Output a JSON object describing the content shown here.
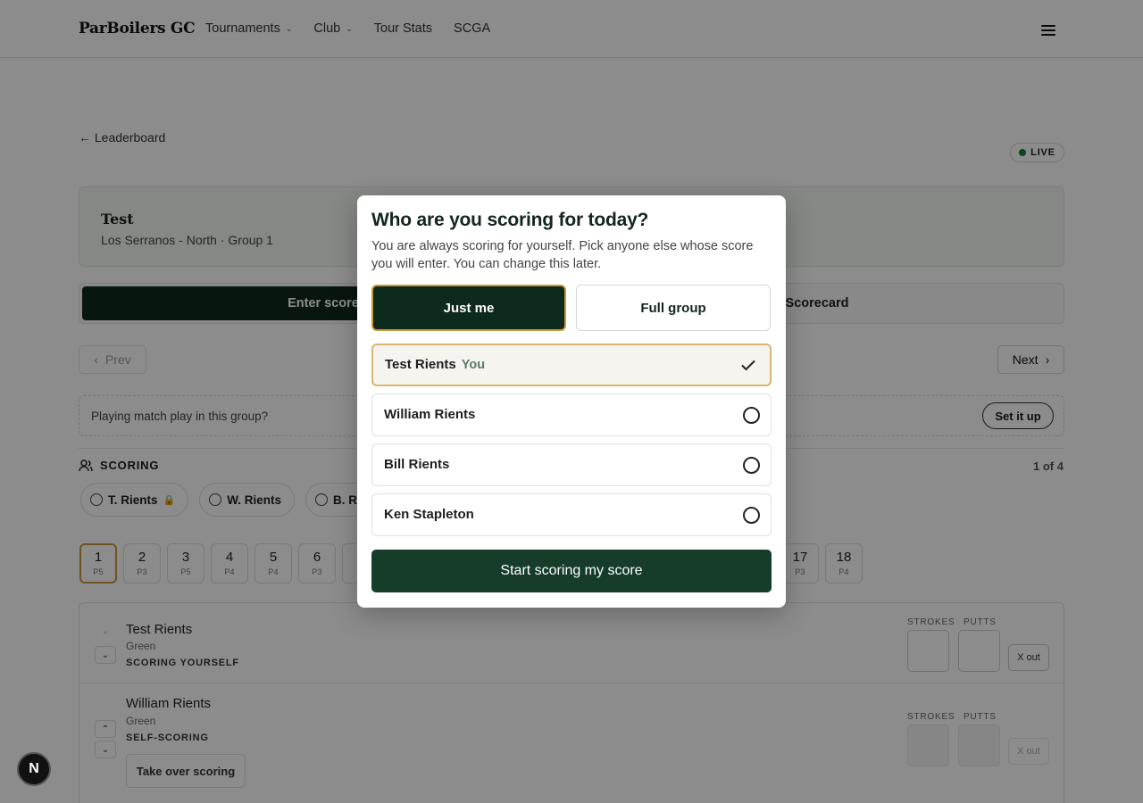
{
  "header": {
    "brand": "ParBoilers GC",
    "nav": [
      {
        "label": "Tournaments",
        "dropdown": true
      },
      {
        "label": "Club",
        "dropdown": true
      },
      {
        "label": "Tour Stats",
        "dropdown": false
      },
      {
        "label": "SCGA",
        "dropdown": false
      }
    ]
  },
  "page": {
    "back_label": "← Leaderboard",
    "live_label": "LIVE",
    "event_title": "Test",
    "event_sub": "Los Serranos - North · Group 1",
    "tabs": {
      "enter": "Enter scores",
      "scorecard": "Scorecard"
    },
    "prev_label": "Prev",
    "next_label": "Next",
    "match_text": "Playing match play in this group?",
    "setup_label": "Set it up",
    "scoring_label": "SCORING",
    "count_label": "1 of 4",
    "chips": [
      "T. Rients",
      "W. Rients",
      "B. Rients"
    ],
    "holes": [
      {
        "num": "1",
        "par": "P5"
      },
      {
        "num": "2",
        "par": "P3"
      },
      {
        "num": "3",
        "par": "P5"
      },
      {
        "num": "4",
        "par": "P4"
      },
      {
        "num": "5",
        "par": "P4"
      },
      {
        "num": "6",
        "par": "P3"
      },
      {
        "num": "17",
        "par": "P3"
      },
      {
        "num": "18",
        "par": "P4"
      }
    ],
    "players": [
      {
        "name": "Test Rients",
        "tee": "Green",
        "status": "SCORING YOURSELF"
      },
      {
        "name": "William Rients",
        "tee": "Green",
        "status": "SELF-SCORING",
        "action": "Take over scoring"
      }
    ],
    "col_strokes": "STROKES",
    "col_putts": "PUTTS",
    "xout_label": "X out"
  },
  "modal": {
    "title": "Who are you scoring for today?",
    "description": "You are always scoring for yourself. Pick anyone else whose score you will enter. You can change this later.",
    "just_me": "Just me",
    "full_group": "Full group",
    "you_tag": "You",
    "people": [
      {
        "name": "Test Rients",
        "selected": true
      },
      {
        "name": "William Rients",
        "selected": false
      },
      {
        "name": "Bill Rients",
        "selected": false
      },
      {
        "name": "Ken Stapleton",
        "selected": false
      }
    ],
    "start_label": "Start scoring my score"
  },
  "colors": {
    "brand_green": "#0d2a1c",
    "accent_gold": "#c9983a",
    "live_green": "#1b7a3c"
  }
}
